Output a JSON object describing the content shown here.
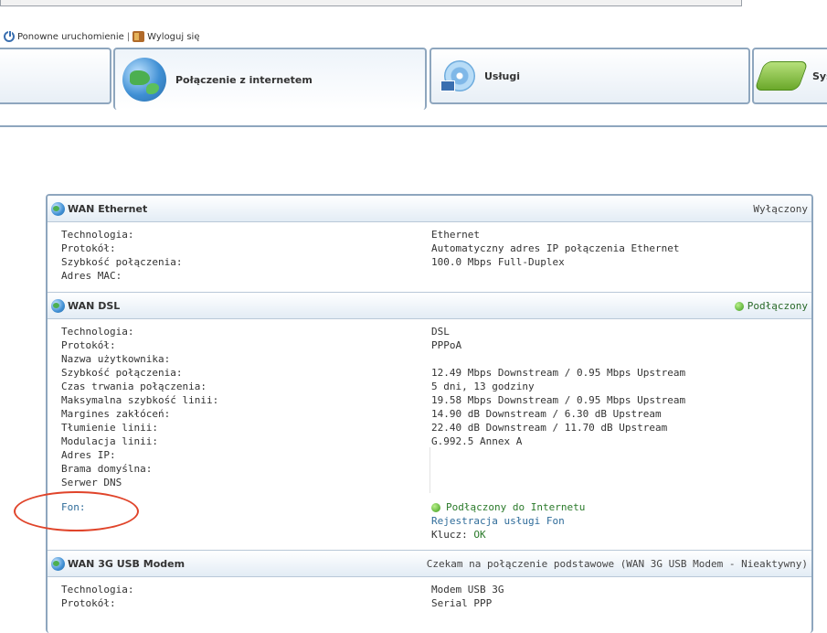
{
  "toolbar": {
    "restart_label": "Ponowne uruchomienie",
    "separator": "|",
    "logout_label": "Wyloguj się",
    "restart_icon": "power-icon",
    "logout_icon": "logout-icon"
  },
  "tabs": [
    {
      "label": "",
      "icon": "none"
    },
    {
      "label": "Połączenie z internetem",
      "icon": "globe-icon",
      "active": true
    },
    {
      "label": "Usługi",
      "icon": "cd-icon"
    },
    {
      "label": "Sys",
      "icon": "system-icon"
    }
  ],
  "sections": {
    "ethernet": {
      "title": "WAN Ethernet",
      "status": "Wyłączony",
      "rows": [
        {
          "label": "Technologia:",
          "value": "Ethernet"
        },
        {
          "label": "Protokół:",
          "value": "Automatyczny adres IP połączenia Ethernet"
        },
        {
          "label": "Szybkość połączenia:",
          "value": "100.0 Mbps Full-Duplex"
        },
        {
          "label": "Adres MAC:",
          "value": ""
        }
      ]
    },
    "dsl": {
      "title": "WAN DSL",
      "status": "Podłączony",
      "rows": [
        {
          "label": "Technologia:",
          "value": "DSL"
        },
        {
          "label": "Protokół:",
          "value": "PPPoA"
        },
        {
          "label": "Nazwa użytkownika:",
          "value": ""
        },
        {
          "label": "Szybkość połączenia:",
          "value": "12.49 Mbps Downstream / 0.95 Mbps Upstream"
        },
        {
          "label": "Czas trwania połączenia:",
          "value": "5 dni, 13 godziny"
        },
        {
          "label": "Maksymalna szybkość linii:",
          "value": "19.58 Mbps Downstream / 0.95 Mbps Upstream"
        },
        {
          "label": "Margines zakłóceń:",
          "value": "14.90 dB Downstream / 6.30 dB Upstream"
        },
        {
          "label": "Tłumienie linii:",
          "value": "22.40 dB Downstream / 11.70 dB Upstream"
        },
        {
          "label": "Modulacja linii:",
          "value": "G.992.5 Annex A"
        },
        {
          "label": "Adres IP:",
          "value": ""
        },
        {
          "label": "Brama domyślna:",
          "value": ""
        },
        {
          "label": "Serwer DNS",
          "value": ""
        }
      ],
      "fon": {
        "label": "Fon:",
        "status": "Podłączony do Internetu",
        "register_link": "Rejestracja usługi Fon",
        "key_label": "Klucz:",
        "key_value": "OK"
      }
    },
    "usb3g": {
      "title": "WAN 3G USB Modem",
      "status": "Czekam na połączenie podstawowe (WAN 3G USB Modem - Nieaktywny)",
      "rows": [
        {
          "label": "Technologia:",
          "value": "Modem USB 3G"
        },
        {
          "label": "Protokół:",
          "value": "Serial PPP"
        }
      ]
    }
  },
  "colors": {
    "border": "#8ea6be",
    "link": "#2f6c9a",
    "connected": "#2a7a2a",
    "annotation": "#e0442a"
  }
}
